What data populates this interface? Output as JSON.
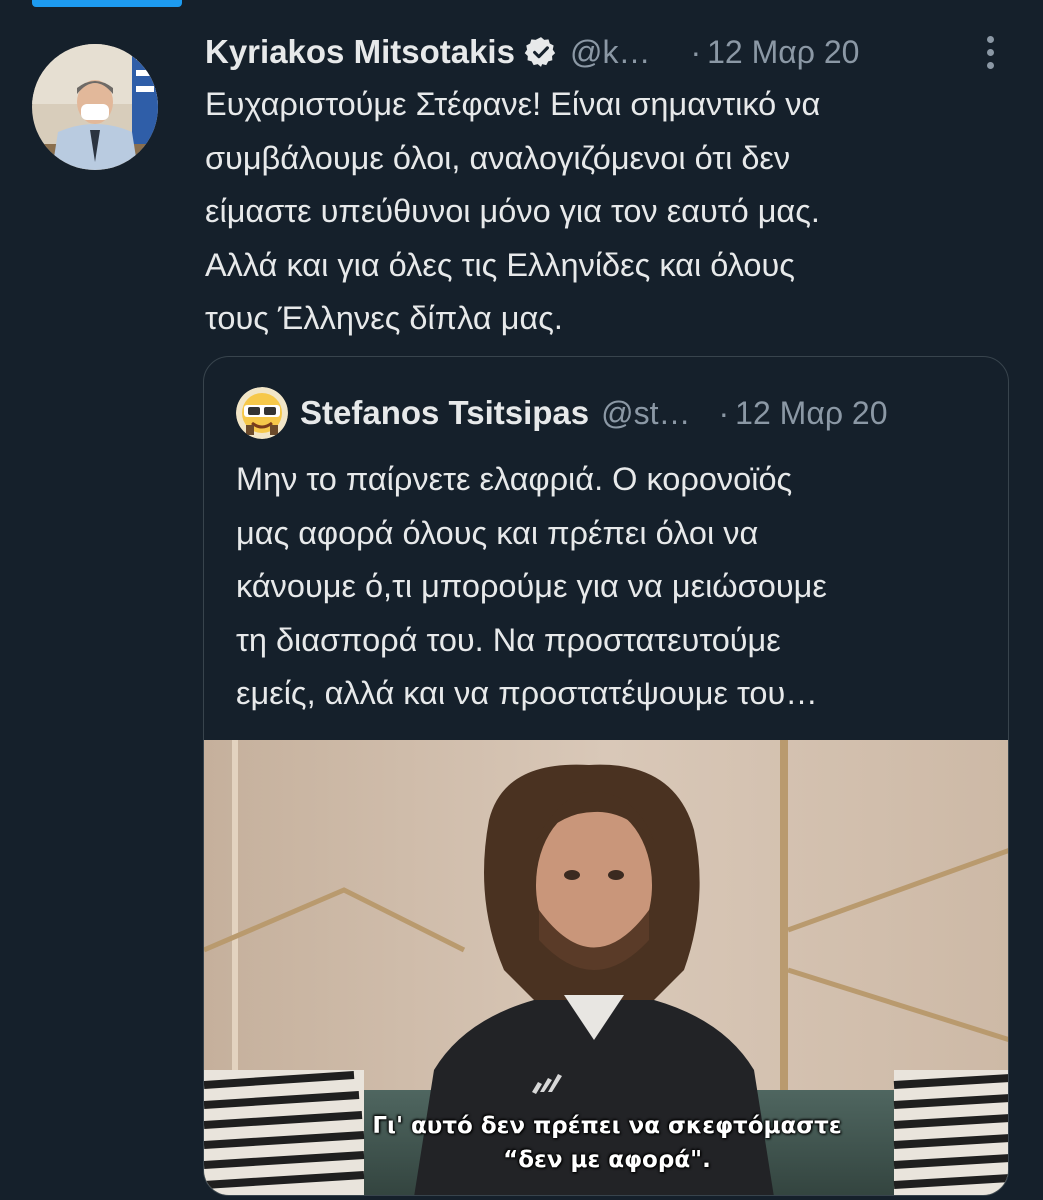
{
  "tweet": {
    "author_name": "Kyriakos Mitsotakis",
    "handle": "@k…",
    "separator": "·",
    "date": "12 Μαρ 20",
    "text_lines": [
      "Ευχαριστούμε Στέφανε! Είναι σημαντικό να",
      "συμβάλουμε όλοι, αναλογιζόμενοι ότι δεν",
      "είμαστε υπεύθυνοι μόνο για τον εαυτό μας.",
      "Αλλά και για όλες τις Ελληνίδες και όλους",
      "τους Έλληνες δίπλα μας."
    ],
    "verified_icon": "verified-badge-icon",
    "more_icon": "more-options-icon"
  },
  "quoted": {
    "author_name": "Stefanos Tsitsipas",
    "handle": "@st…",
    "separator": "·",
    "date": "12 Μαρ 20",
    "text_lines": [
      "Μην το παίρνετε ελαφριά. Ο κορονοϊός",
      "μας αφορά όλους και πρέπει όλοι να",
      "κάνουμε ό,τι μπορούμε για να μειώσουμε",
      "τη διασπορά του. Να προστατευτούμε",
      "εμείς, αλλά και να προστατέψουμε του…"
    ],
    "video": {
      "subtitle_line1": "Γι' αυτό δεν πρέπει να σκεφτόμαστε",
      "subtitle_line2": "“δεν με αφορά\"."
    }
  },
  "colors": {
    "background": "#15202b",
    "text_primary": "#e7e9ea",
    "text_secondary": "#8b98a5",
    "accent": "#1d9bf0",
    "border": "#38444d"
  }
}
